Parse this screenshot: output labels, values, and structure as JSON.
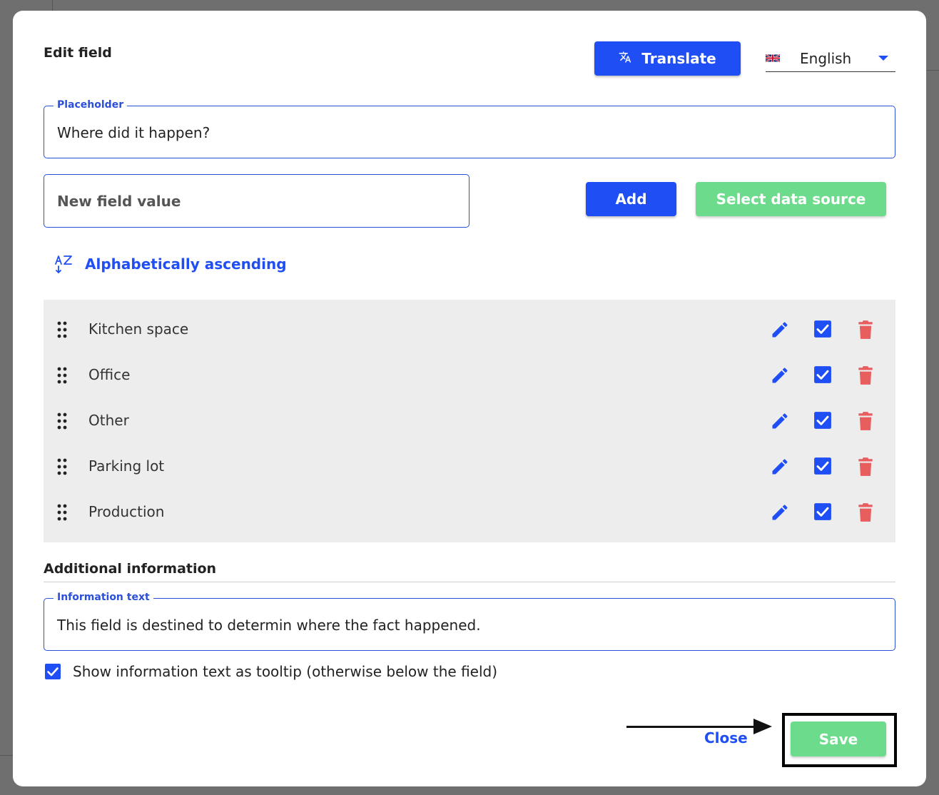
{
  "dialog": {
    "title": "Edit field"
  },
  "header": {
    "translate_label": "Translate",
    "translate_icon": "translate-icon",
    "language": {
      "flag": "uk-flag-icon",
      "selected": "English"
    }
  },
  "placeholder_field": {
    "label": "Placeholder",
    "value": "Where did it happen?"
  },
  "new_value_field": {
    "placeholder": "New field value"
  },
  "actions": {
    "add_label": "Add",
    "data_source_label": "Select data source"
  },
  "sort": {
    "label": "Alphabetically ascending",
    "icon": "sort-az-icon"
  },
  "values": [
    {
      "label": "Kitchen space",
      "enabled": true
    },
    {
      "label": "Office",
      "enabled": true
    },
    {
      "label": "Other",
      "enabled": true
    },
    {
      "label": "Parking lot",
      "enabled": true
    },
    {
      "label": "Production",
      "enabled": true
    }
  ],
  "additional_info": {
    "section_title": "Additional information",
    "info_label": "Information text",
    "info_value": "This field is destined to determin where the fact happened.",
    "tooltip_checkbox_label": "Show information text as tooltip (otherwise below the field)",
    "tooltip_checked": true
  },
  "footer": {
    "close_label": "Close",
    "save_label": "Save"
  },
  "colors": {
    "primary": "#1f4ef5",
    "success": "#6cdc8c",
    "danger": "#e85d5d",
    "list_bg": "#ededed"
  }
}
